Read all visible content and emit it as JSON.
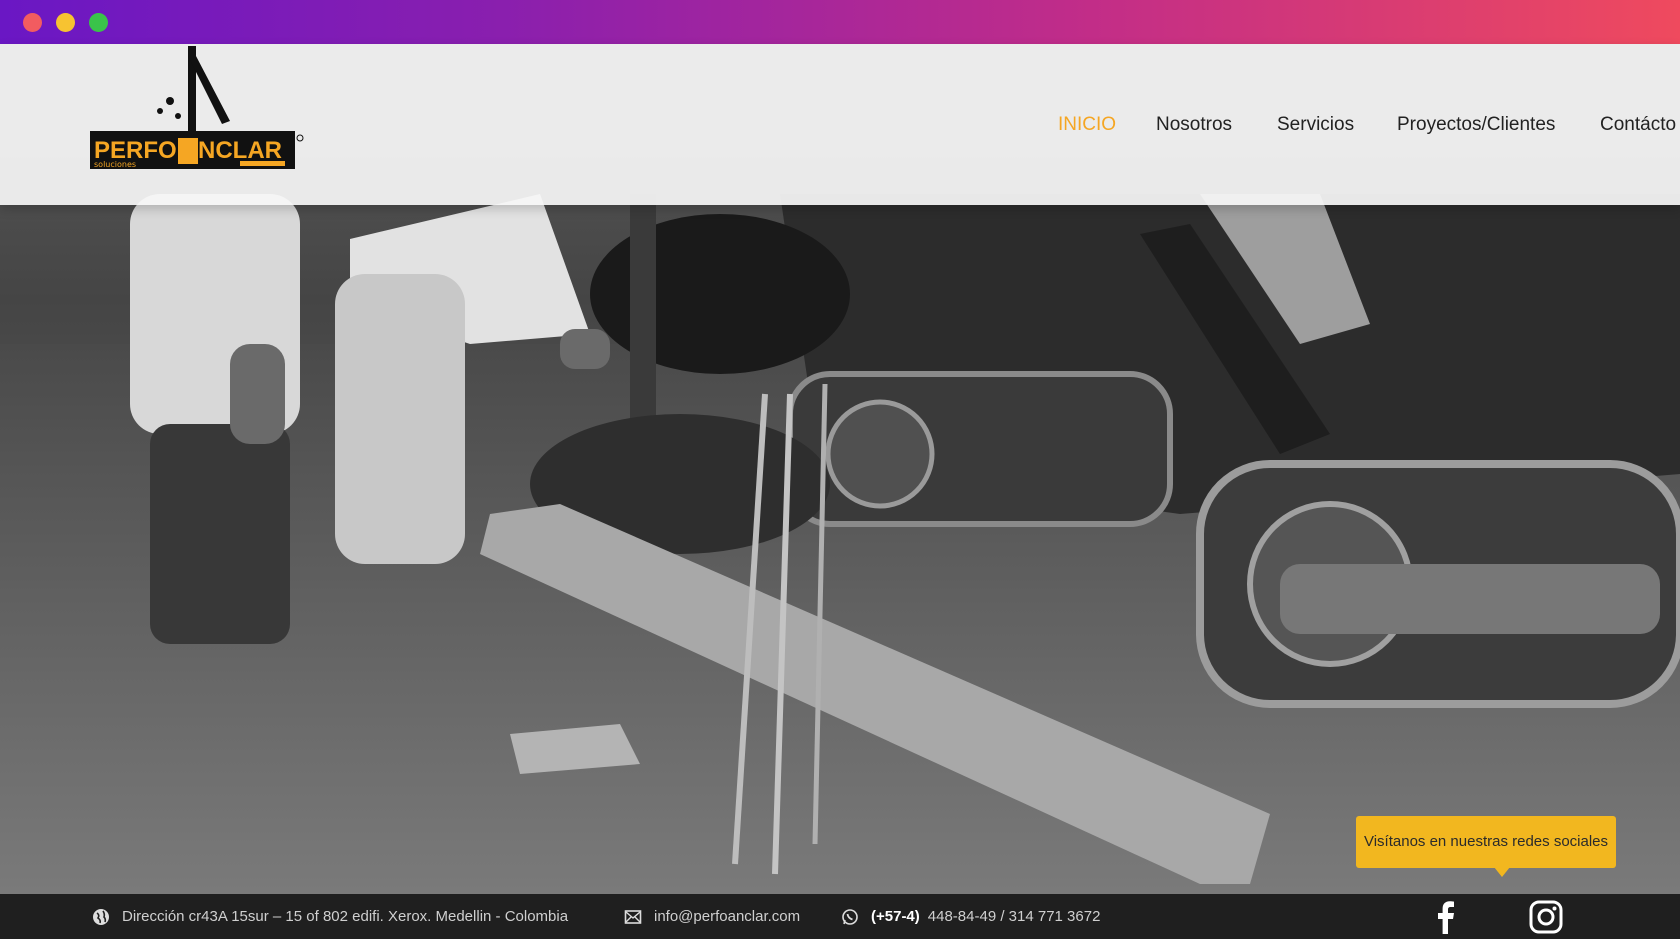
{
  "nav": {
    "items": [
      {
        "label": "INICIO",
        "active": true
      },
      {
        "label": "Nosotros",
        "active": false
      },
      {
        "label": "Servicios",
        "active": false
      },
      {
        "label": "Proyectos/Clientes",
        "active": false
      },
      {
        "label": "Contácto",
        "active": false
      }
    ]
  },
  "logo": {
    "brand_left": "PERFO",
    "brand_right": "NCLAR",
    "tagline": "soluciones"
  },
  "tooltip": {
    "text": "Visítanos en nuestras redes sociales"
  },
  "footer": {
    "address": "Dirección cr43A 15sur – 15 of 802 edifi. Xerox. Medellin - Colombia",
    "email": "info@perfoanclar.com",
    "phone_prefix": "(+57-4)",
    "phone_numbers": "448-84-49 / 314 771 3672"
  },
  "social": {
    "facebook_icon": "facebook-icon",
    "instagram_icon": "instagram-icon"
  },
  "colors": {
    "accent": "#f5a623",
    "tooltip_bg": "#f2b71f",
    "footer_bg": "#1f1f1f"
  }
}
